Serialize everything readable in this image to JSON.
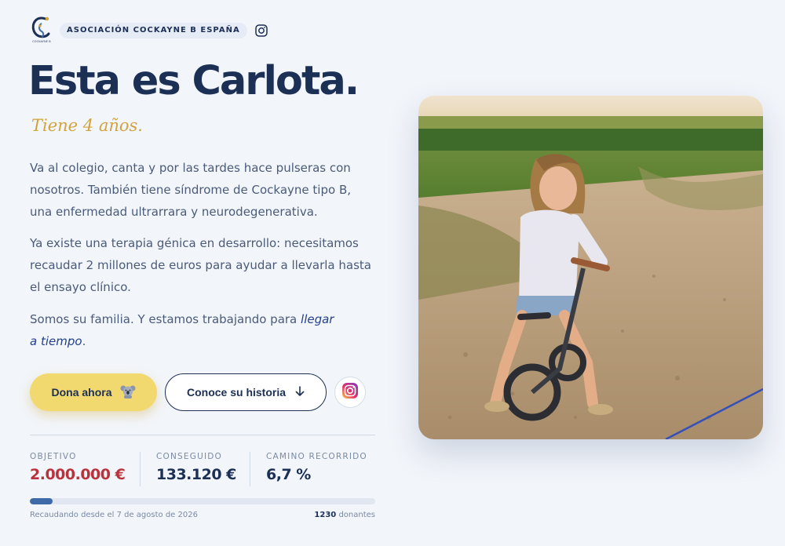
{
  "header": {
    "org_name": "ASOCIACIÓN COCKAYNE B ESPAÑA",
    "logo_text": "COCKAYNE B",
    "icons": [
      "logo-icon",
      "instagram-icon"
    ]
  },
  "hero": {
    "title": "Esta es Carlota.",
    "subtitle": "Tiene 4 años.",
    "paragraph1": "Va al colegio, canta y por las tardes hace pulseras con nosotros. También tiene síndrome de Cockayne tipo B, una enfermedad ultrarrara y neurodegenerativa.",
    "paragraph2": "Ya existe una terapia génica en desarrollo: necesitamos recaudar 2 millones de euros para ayudar a llevarla hasta el ensayo clínico.",
    "paragraph3_start": "Somos su familia. Y estamos trabajando para ",
    "paragraph3_emphasis": "llegar a tiempo",
    "paragraph3_end": "."
  },
  "actions": {
    "donate_label": "Dona ahora",
    "story_label": "Conoce su historia",
    "donate_icon": "koala-icon",
    "story_icon": "arrow-down-icon",
    "instagram_icon": "instagram-icon"
  },
  "stats": {
    "goal_label": "OBJETIVO",
    "goal_value": "2.000.000 €",
    "raised_label": "CONSEGUIDO",
    "raised_value": "133.120 €",
    "progress_label": "CAMINO RECORRIDO",
    "progress_value": "6,7 %",
    "progress_fraction": 0.067
  },
  "footer": {
    "since": "Recaudando desde el 7 de agosto de 2026",
    "donors_count": "1230",
    "donors_label": " donantes"
  },
  "colors": {
    "navy": "#1c2f55",
    "gold": "#d2a23c",
    "donate_yellow": "#f2d96f",
    "goal_red": "#b8333b",
    "progress_blue": "#3f6aa8"
  }
}
